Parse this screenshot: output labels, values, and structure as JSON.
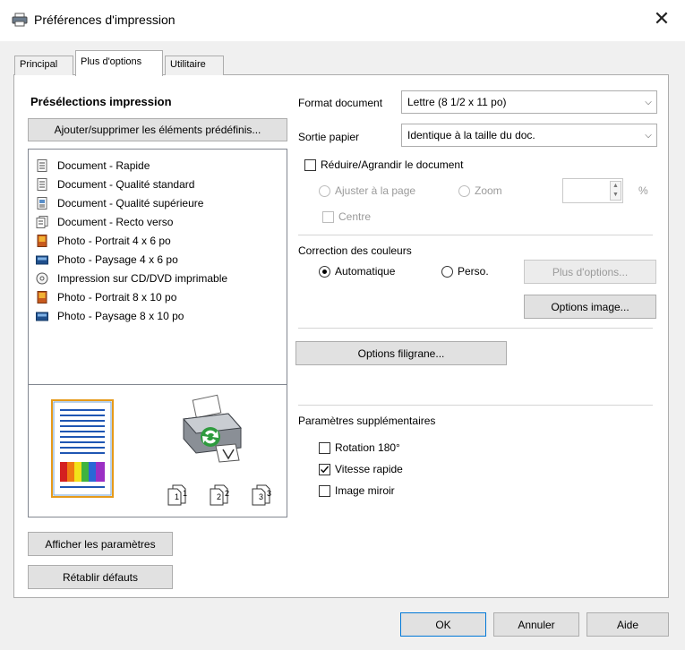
{
  "window": {
    "title": "Préférences d'impression",
    "close_glyph": "✕"
  },
  "tabs": [
    {
      "label": "Principal",
      "active": false
    },
    {
      "label": "Plus d'options",
      "active": true
    },
    {
      "label": "Utilitaire",
      "active": false
    }
  ],
  "presets": {
    "heading": "Présélections impression",
    "add_remove_button": "Ajouter/supprimer les éléments prédéfinis...",
    "items": [
      {
        "label": "Document - Rapide",
        "icon": "document-icon"
      },
      {
        "label": "Document - Qualité standard",
        "icon": "document-icon"
      },
      {
        "label": "Document - Qualité supérieure",
        "icon": "document-photo-icon"
      },
      {
        "label": "Document - Recto verso",
        "icon": "duplex-document-icon"
      },
      {
        "label": "Photo - Portrait 4 x 6 po",
        "icon": "photo-portrait-icon"
      },
      {
        "label": "Photo - Paysage 4 x 6 po",
        "icon": "photo-landscape-icon"
      },
      {
        "label": "Impression sur CD/DVD imprimable",
        "icon": "cd-icon"
      },
      {
        "label": "Photo - Portrait 8 x 10 po",
        "icon": "photo-portrait-icon"
      },
      {
        "label": "Photo - Paysage 8 x 10 po",
        "icon": "photo-landscape-icon"
      }
    ],
    "show_settings_button": "Afficher les paramètres",
    "restore_defaults_button": "Rétablir défauts"
  },
  "preview": {
    "copy_labels": [
      "1",
      "1",
      "2",
      "2",
      "3",
      "3"
    ]
  },
  "paper": {
    "document_size_label": "Format document",
    "document_size_value": "Lettre (8 1/2 x 11 po)",
    "output_paper_label": "Sortie papier",
    "output_paper_value": "Identique à la taille du doc.",
    "reduce_enlarge_label": "Réduire/Agrandir le document",
    "reduce_enlarge_checked": false,
    "fit_to_page_label": "Ajuster à la page",
    "zoom_label": "Zoom",
    "zoom_value": "",
    "zoom_unit": "%",
    "center_label": "Centre"
  },
  "color": {
    "heading": "Correction des couleurs",
    "automatic_label": "Automatique",
    "custom_label": "Perso.",
    "selected": "Automatique",
    "more_options_button": "Plus d'options...",
    "image_options_button": "Options image..."
  },
  "watermark_button": "Options filigrane...",
  "extra": {
    "heading": "Paramètres supplémentaires",
    "rotate_label": "Rotation 180°",
    "rotate_checked": false,
    "high_speed_label": "Vitesse rapide",
    "high_speed_checked": true,
    "mirror_label": "Image miroir",
    "mirror_checked": false
  },
  "footer": {
    "ok_button": "OK",
    "cancel_button": "Annuler",
    "help_button": "Aide"
  },
  "colors": {
    "accent_blue": "#0078d7",
    "border_gray": "#adadad",
    "dialog_bg": "#f0f0f0"
  }
}
